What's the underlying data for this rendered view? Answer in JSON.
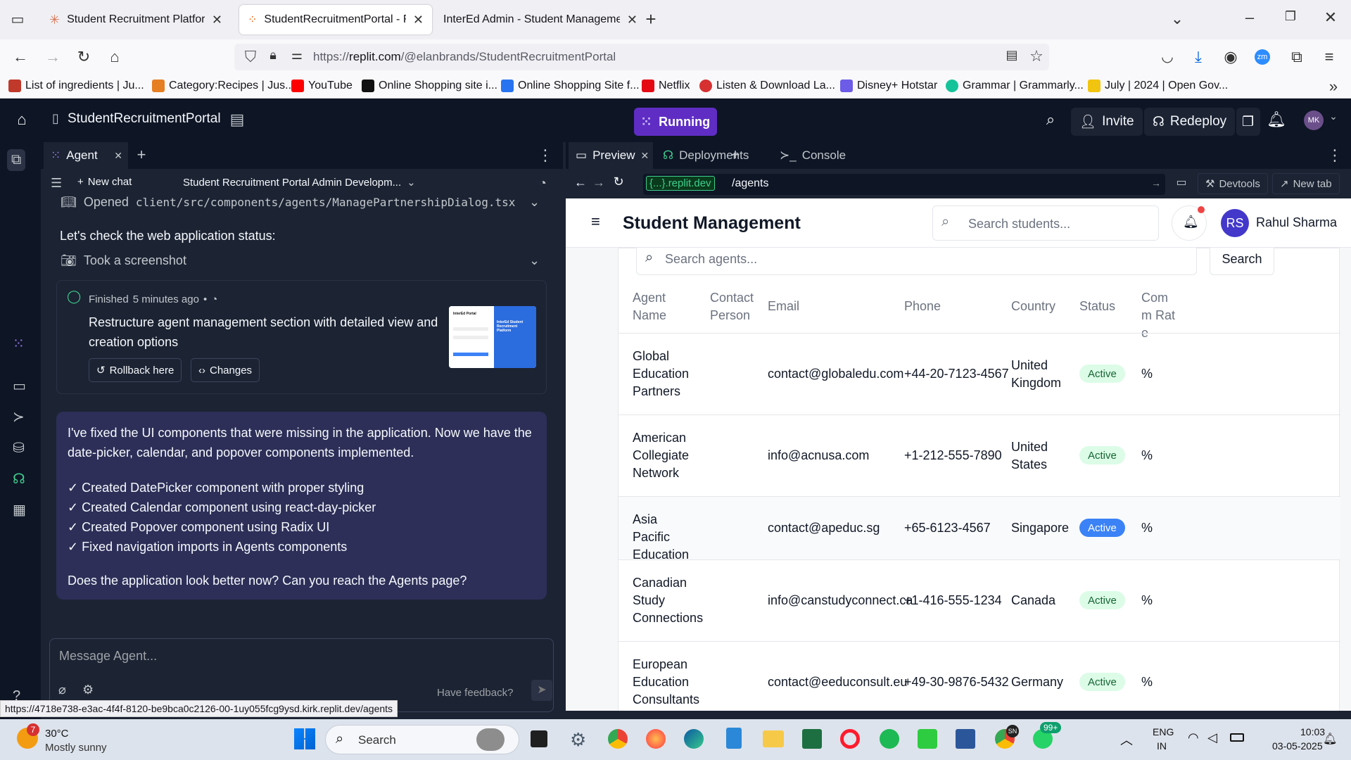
{
  "browser": {
    "tabs": [
      {
        "title": "Student Recruitment Platform D"
      },
      {
        "title": "StudentRecruitmentPortal - Rep"
      },
      {
        "title": "InterEd Admin - Student Manageme"
      }
    ],
    "url_prefix": "https://",
    "url_host": "replit.com",
    "url_path": "/@elanbrands/StudentRecruitmentPortal",
    "bookmarks": [
      {
        "label": "List of ingredients | Ju...",
        "color": "#c0392b"
      },
      {
        "label": "Category:Recipes | Jus...",
        "color": "#e67e22"
      },
      {
        "label": "YouTube",
        "color": "#ff0000"
      },
      {
        "label": "Online Shopping site i...",
        "color": "#111111"
      },
      {
        "label": "Online Shopping Site f...",
        "color": "#2874f0"
      },
      {
        "label": "Netflix",
        "color": "#e50914"
      },
      {
        "label": "Listen & Download La...",
        "color": "#d63031"
      },
      {
        "label": "Disney+ Hotstar",
        "color": "#6c5ce7"
      },
      {
        "label": "Grammar | Grammarly...",
        "color": "#15c39a"
      },
      {
        "label": "July | 2024 | Open Gov...",
        "color": "#f1c40f"
      }
    ]
  },
  "replit": {
    "project_name": "StudentRecruitmentPortal",
    "status": "Running",
    "invite": "Invite",
    "redeploy": "Redeploy",
    "user_initials": "MK"
  },
  "agent": {
    "tab_label": "Agent",
    "new_chat": "New chat",
    "chat_title": "Student Recruitment Portal Admin Developm...",
    "opened_label": "Opened",
    "opened_file": "client/src/components/agents/ManagePartnershipDialog.tsx",
    "status_line": "Let's check the web application status:",
    "screenshot_label": "Took a screenshot",
    "finished": "Finished",
    "finished_time": "5 minutes ago",
    "checkpoint_text": "Restructure agent management section with detailed view and creation options",
    "rollback": "Rollback here",
    "changes": "Changes",
    "thumb_title": "InterEd Portal",
    "thumb_title2": "InterEd Student Recruitment Platform",
    "message_intro": "I've fixed the UI components that were missing in the application. Now we have the date-picker, calendar, and popover components implemented.",
    "checklist": [
      "✓ Created DatePicker component with proper styling",
      "✓ Created Calendar component using react-day-picker",
      "✓ Created Popover component using Radix UI",
      "✓ Fixed navigation imports in Agents components"
    ],
    "message_question": "Does the application look better now? Can you reach the Agents page?",
    "input_placeholder": "Message Agent...",
    "feedback": "Have feedback?"
  },
  "preview": {
    "tabs": [
      "Preview",
      "Deployments",
      "Console"
    ],
    "domain": "{...}.replit.dev",
    "path": "/agents",
    "devtools": "Devtools",
    "newtab": "New tab"
  },
  "app": {
    "title": "Student Management",
    "search_placeholder": "Search students...",
    "user_initials": "RS",
    "user_name": "Rahul Sharma",
    "agent_search_placeholder": "Search agents...",
    "search_button": "Search",
    "columns": [
      "Agent Name",
      "Contact Person",
      "Email",
      "Phone",
      "Country",
      "Status",
      "Comm Rate"
    ],
    "rows": [
      {
        "name": "Global Education Partners",
        "contact": "",
        "email": "contact@globaledu.com",
        "phone": "+44-20-7123-4567",
        "country": "United Kingdom",
        "status": "Active",
        "rate": "%"
      },
      {
        "name": "American Collegiate Network",
        "contact": "",
        "email": "info@acnusa.com",
        "phone": "+1-212-555-7890",
        "country": "United States",
        "status": "Active",
        "rate": "%"
      },
      {
        "name": "Asia Pacific Education",
        "contact": "",
        "email": "contact@apeduc.sg",
        "phone": "+65-6123-4567",
        "country": "Singapore",
        "status": "Active",
        "rate": "%"
      },
      {
        "name": "Canadian Study Connections",
        "contact": "",
        "email": "info@canstudyconnect.ca",
        "phone": "+1-416-555-1234",
        "country": "Canada",
        "status": "Active",
        "rate": "%"
      },
      {
        "name": "European Education Consultants",
        "contact": "",
        "email": "contact@eeduconsult.eu",
        "phone": "+49-30-9876-5432",
        "country": "Germany",
        "status": "Active",
        "rate": "%"
      }
    ]
  },
  "statusbar": {
    "link": "https://4718e738-e3ac-4f4f-8120-be9bca0c2126-00-1uy055fcg9ysd.kirk.replit.dev/agents"
  },
  "taskbar": {
    "weather_badge": "7",
    "temperature": "30°C",
    "condition": "Mostly sunny",
    "search": "Search",
    "whatsapp_badge": "99+",
    "chrome_badge": "SN",
    "lang1": "ENG",
    "lang2": "IN",
    "time": "10:03",
    "date": "03-05-2025"
  }
}
